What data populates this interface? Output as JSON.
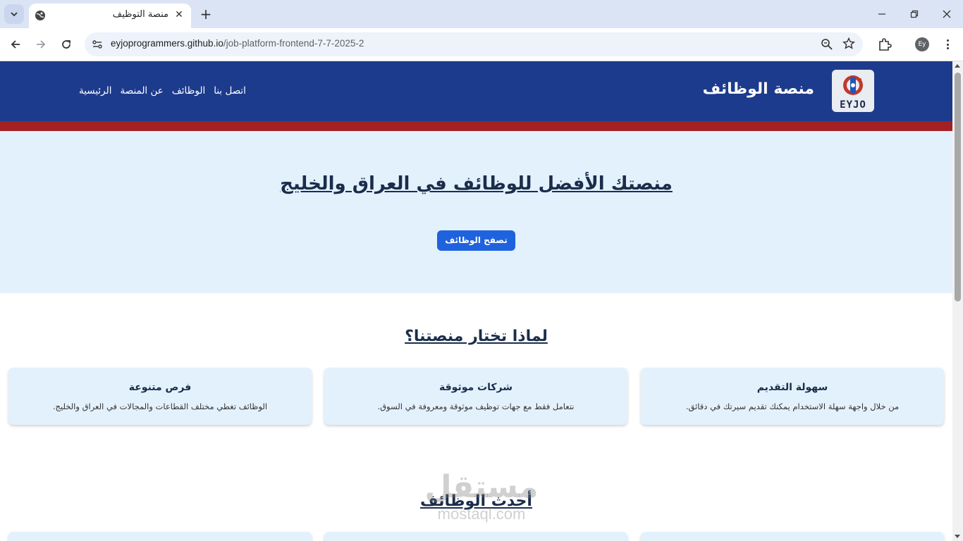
{
  "browser": {
    "tab_title": "منصة التوظيف",
    "url_host": "eyjoprogrammers.github.io",
    "url_path": "/job-platform-frontend-7-7-2025-2",
    "profile_initials": "Ey"
  },
  "header": {
    "brand": "منصة الوظائف",
    "logo_text": "EYJO",
    "nav": [
      "الرئيسية",
      "عن المنصة",
      "الوظائف",
      "اتصل بنا"
    ]
  },
  "hero": {
    "title": "منصتك الأفضل للوظائف في العراق والخليج",
    "cta": "تصفح الوظائف"
  },
  "why": {
    "title": "لماذا تختار منصتنا؟",
    "cards": [
      {
        "title": "سهولة التقديم",
        "desc": "من خلال واجهة سهلة الاستخدام يمكنك تقديم سيرتك في دقائق."
      },
      {
        "title": "شركات موثوقة",
        "desc": "نتعامل فقط مع جهات توظيف موثوقة ومعروفة في السوق."
      },
      {
        "title": "فرص متنوعة",
        "desc": "الوظائف تغطي مختلف القطاعات والمجالات في العراق والخليج."
      }
    ]
  },
  "latest": {
    "title": "أحدث الوظائف"
  },
  "watermark": {
    "arabic": "مستقل",
    "latin": "mostaql.com"
  },
  "colors": {
    "header_bg": "#1d3b8c",
    "accent_red": "#a32024",
    "hero_bg": "#e3f1fd",
    "button": "#1f62dd"
  }
}
